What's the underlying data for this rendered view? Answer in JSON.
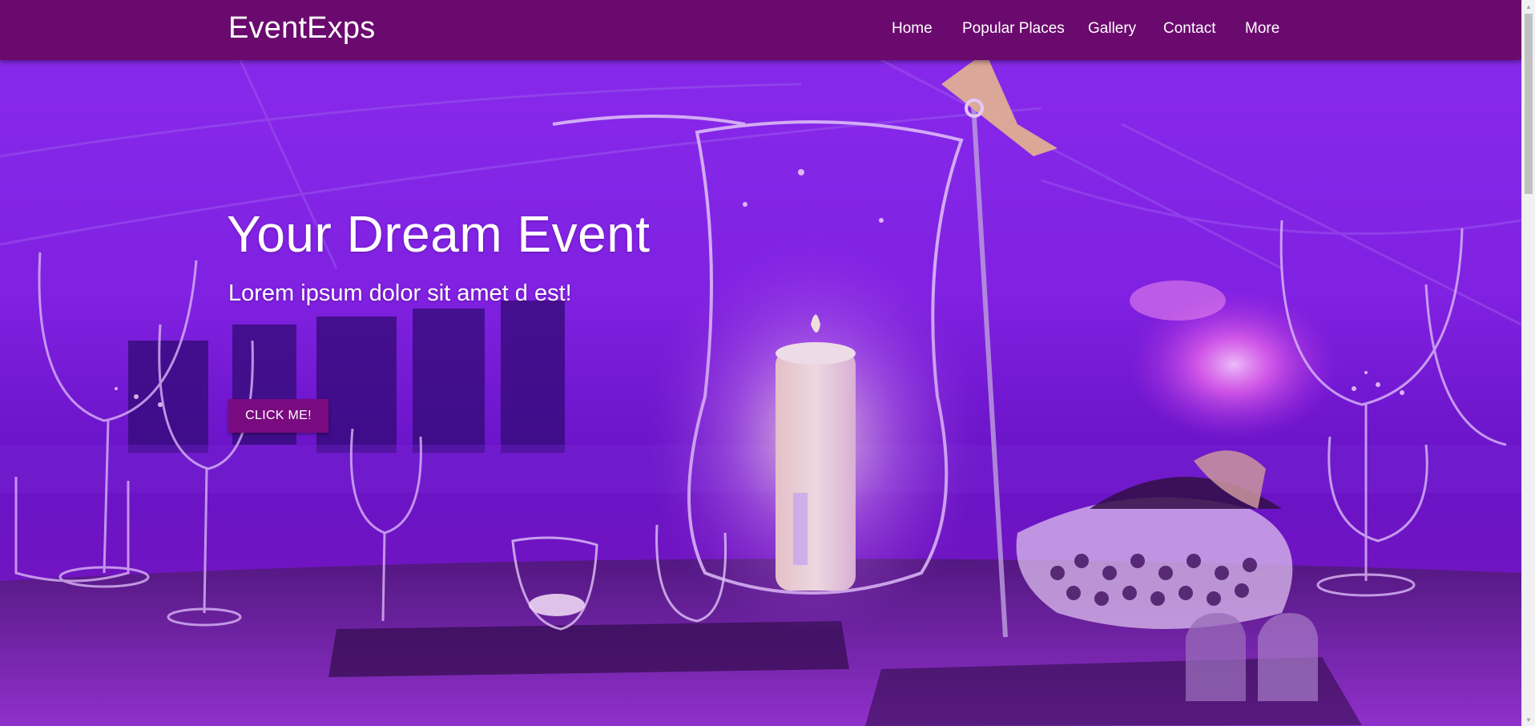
{
  "navbar": {
    "brand": "EventExps",
    "links": [
      {
        "label": "Home"
      },
      {
        "label": "Popular Places"
      },
      {
        "label": "Gallery"
      },
      {
        "label": "Contact"
      },
      {
        "label": "More"
      }
    ]
  },
  "hero": {
    "title": "Your Dream Event",
    "subtitle": "Lorem ipsum dolor sit amet d est!",
    "button_label": "CLICK ME!"
  },
  "colors": {
    "navbar": "#6b0a6e",
    "button": "#7a0a80",
    "hero_tint": "#8a1ee0"
  },
  "scrollbar": {
    "up_icon": "scroll-up-arrow-icon",
    "down_icon": "scroll-down-arrow-icon"
  }
}
